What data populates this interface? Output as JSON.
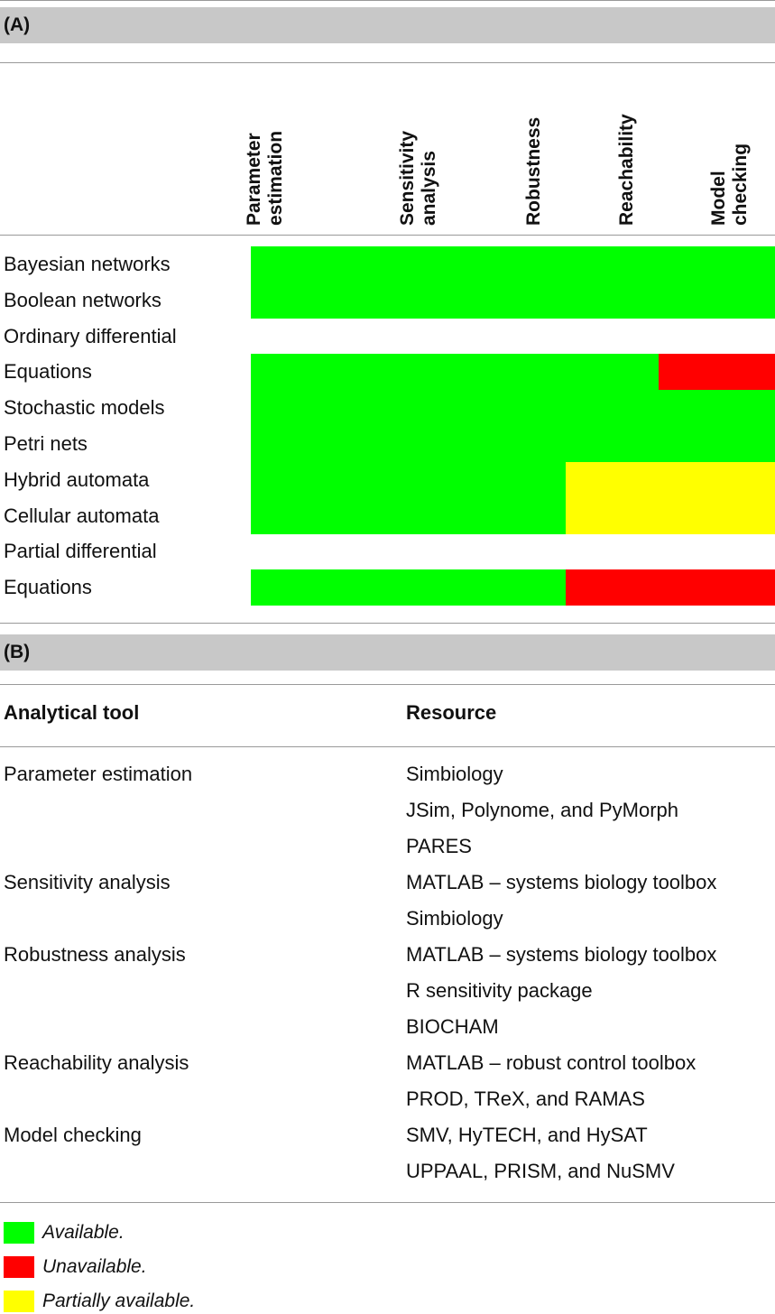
{
  "colors": {
    "available": "#00ff00",
    "unavailable": "#ff0000",
    "partial": "#ffff00"
  },
  "panel_a": {
    "label": "(A)",
    "columns": [
      "Parameter\nestimation",
      "Sensitivity\nanalysis",
      "Robustness",
      "Reachability",
      "Model\nchecking"
    ],
    "rows": [
      {
        "label": "Bayesian networks",
        "cells": [
          "available",
          "available",
          "available",
          "available",
          "available"
        ]
      },
      {
        "label": "Boolean networks",
        "cells": [
          "available",
          "available",
          "available",
          "available",
          "available"
        ]
      },
      {
        "label": "Ordinary differential",
        "cells": []
      },
      {
        "label": "Equations",
        "cells": [
          "available",
          "available",
          "available",
          "available",
          "unavailable"
        ]
      },
      {
        "label": "Stochastic models",
        "cells": [
          "available",
          "available",
          "available",
          "available",
          "available"
        ]
      },
      {
        "label": "Petri nets",
        "cells": [
          "available",
          "available",
          "available",
          "available",
          "available"
        ]
      },
      {
        "label": "Hybrid automata",
        "cells": [
          "available",
          "available",
          "available",
          "partial",
          "partial"
        ]
      },
      {
        "label": "Cellular automata",
        "cells": [
          "available",
          "available",
          "available",
          "partial",
          "partial"
        ]
      },
      {
        "label": "Partial differential",
        "cells": []
      },
      {
        "label": "Equations",
        "cells": [
          "available",
          "available",
          "available",
          "unavailable",
          "unavailable"
        ]
      }
    ]
  },
  "panel_b": {
    "label": "(B)",
    "headers": [
      "Analytical tool",
      "Resource"
    ],
    "rows": [
      [
        "Parameter estimation",
        "Simbiology"
      ],
      [
        "",
        "JSim, Polynome, and PyMorph"
      ],
      [
        "",
        "PARES"
      ],
      [
        "Sensitivity analysis",
        "MATLAB – systems biology toolbox"
      ],
      [
        "",
        "Simbiology"
      ],
      [
        "Robustness analysis",
        "MATLAB – systems biology toolbox"
      ],
      [
        "",
        "R sensitivity package"
      ],
      [
        "",
        "BIOCHAM"
      ],
      [
        "Reachability analysis",
        "MATLAB – robust control toolbox"
      ],
      [
        "",
        "PROD, TReX, and RAMAS"
      ],
      [
        "Model checking",
        "SMV, HyTECH, and HySAT"
      ],
      [
        "",
        "UPPAAL, PRISM, and NuSMV"
      ]
    ]
  },
  "legend": [
    {
      "status": "available",
      "label": "Available."
    },
    {
      "status": "unavailable",
      "label": "Unavailable."
    },
    {
      "status": "partial",
      "label": "Partially available."
    }
  ]
}
